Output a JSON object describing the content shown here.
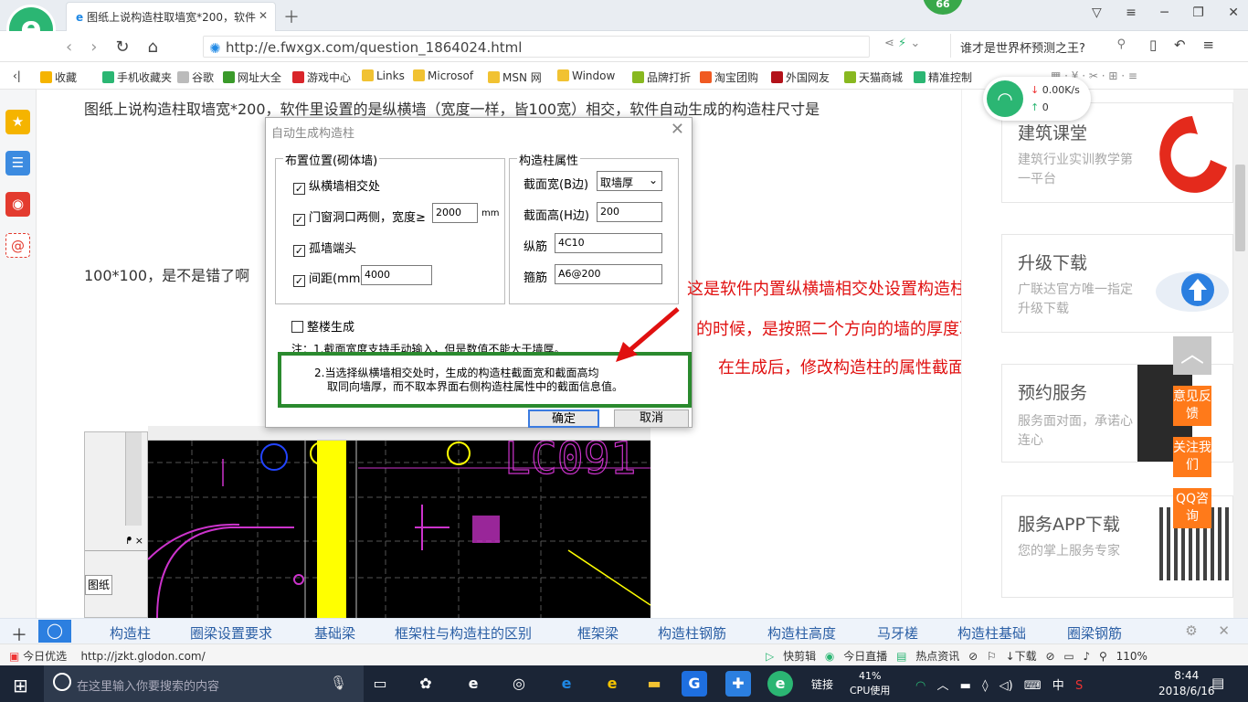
{
  "browser": {
    "tab_title": "图纸上说构造柱取墙宽*200，软件",
    "badge_count": "66",
    "url": "http://e.fwxgx.com/question_1864024.html",
    "search_placeholder": "谁才是世界杯预测之王?"
  },
  "favorites": [
    {
      "label": "收藏",
      "color": "#f5b400"
    },
    {
      "label": "手机收藏夹",
      "color": "#2bb673"
    },
    {
      "label": "谷歌",
      "color": "#bbbbbb"
    },
    {
      "label": "网址大全",
      "color": "#3a9a2a"
    },
    {
      "label": "游戏中心",
      "color": "#d9252a"
    },
    {
      "label": "Links",
      "color": "#f1c232"
    },
    {
      "label": "Microsof",
      "color": "#f1c232"
    },
    {
      "label": "MSN 网",
      "color": "#f1c232"
    },
    {
      "label": "Window",
      "color": "#f1c232"
    },
    {
      "label": "品牌打折",
      "color": "#88b820"
    },
    {
      "label": "淘宝团购",
      "color": "#f05a22"
    },
    {
      "label": "外国网友",
      "color": "#b3121a"
    },
    {
      "label": "天猫商城",
      "color": "#88b820"
    },
    {
      "label": "精准控制",
      "color": "#2bb673"
    }
  ],
  "wifi_widget": {
    "down": "0.00K/s",
    "up": "0"
  },
  "question": {
    "line1": "图纸上说构造柱取墙宽*200，软件里设置的是纵横墙（宽度一样，皆100宽）相交，软件自动生成的构造柱尺寸是",
    "line2": "100*100，是不是错了啊"
  },
  "dialog": {
    "title": "自动生成构造柱",
    "group_left": "布置位置(砌体墙)",
    "cb_cross": "纵横墙相交处",
    "cb_door": "门窗洞口两侧，宽度≥",
    "door_width": "2000",
    "unit_mm": "mm",
    "cb_isolated": "孤墙端头",
    "cb_spacing": "间距(mm)",
    "spacing": "4000",
    "group_right": "构造柱属性",
    "sec_width_label": "截面宽(B边)",
    "sec_width_value": "取墙厚",
    "sec_height_label": "截面高(H边)",
    "sec_height_value": "200",
    "long_bar_label": "纵筋",
    "long_bar_value": "4C10",
    "stirrup_label": "箍筋",
    "stirrup_value": "A6@200",
    "whole_floor": "整楼生成",
    "note1": "注：1.截面宽度支持手动输入，但是数值不能大于墙厚。",
    "note2a": "2.当选择纵横墙相交处时，生成的构造柱截面宽和截面高均",
    "note2b": "取同向墙厚，而不取本界面右侧构造柱属性中的截面信息值。",
    "ok": "确定",
    "cancel": "取消"
  },
  "annotation": {
    "line1": "这是软件内置纵横墙相交处设置构造柱",
    "line2": "的时候，是按照二个方向的墙的厚度取值的",
    "line3": "在生成后，修改构造柱的属性截面尺寸"
  },
  "cad": {
    "text": "LC091",
    "panel_pin": "ᖰ ×",
    "tab": "图纸"
  },
  "right_cards": [
    {
      "title": "建筑课堂",
      "sub": "建筑行业实训教学第一平台"
    },
    {
      "title": "升级下载",
      "sub": "广联达官方唯一指定升级下载"
    },
    {
      "title": "预约服务",
      "sub": "服务面对面，承诺心连心"
    },
    {
      "title": "服务APP下载",
      "sub": "您的掌上服务专家"
    }
  ],
  "float_buttons": [
    "意见反馈",
    "关注我们",
    "QQ咨询"
  ],
  "tags": [
    "构造柱",
    "圈梁设置要求",
    "基础梁",
    "框架柱与构造柱的区别",
    "框架梁",
    "构造柱钢筋",
    "构造柱高度",
    "马牙槎",
    "构造柱基础",
    "圈梁钢筋"
  ],
  "statusbar": {
    "left": "今日优选",
    "url": "http://jzkt.glodon.com/",
    "quick_clip": "快剪辑",
    "live": "今日直播",
    "hot": "热点资讯",
    "download": "下载",
    "zoom": "110%"
  },
  "taskbar": {
    "search_placeholder": "在这里输入你要搜索的内容",
    "link": "链接",
    "cpu_pct": "41%",
    "cpu_label": "CPU使用",
    "ime": "中",
    "time": "8:44",
    "date": "2018/6/16"
  }
}
